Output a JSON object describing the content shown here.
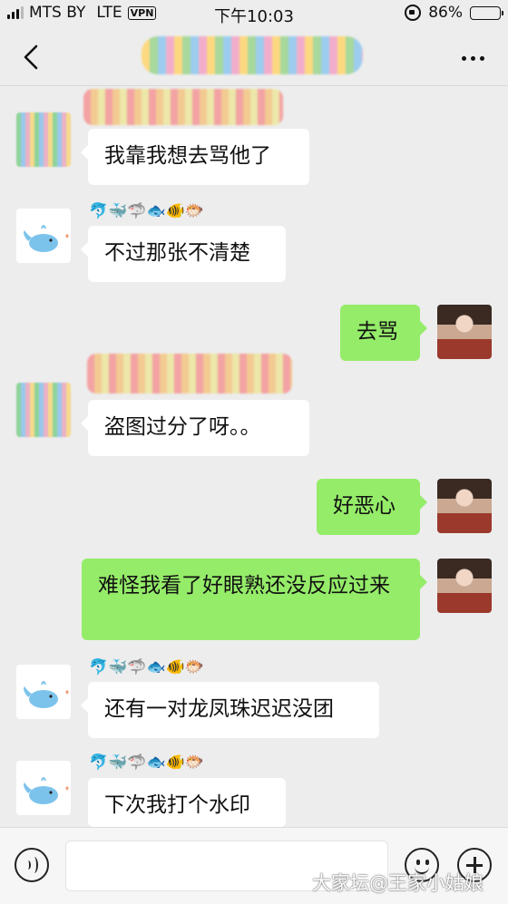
{
  "status_bar": {
    "carrier": "MTS BY",
    "network": "LTE",
    "vpn": "VPN",
    "time": "下午10:03",
    "battery": "86%",
    "battery_level": 0.86
  },
  "chat": {
    "messages": [
      {
        "side": "in",
        "text": "我靠我想去骂他了",
        "avatar": "pixelated",
        "nickname": "pixelated"
      },
      {
        "side": "in",
        "text": "不过那张不清楚",
        "avatar": "whale",
        "nickname_emoji": "🐬🐳🦈🐟🐠🐡"
      },
      {
        "side": "out",
        "text": "去骂",
        "avatar": "photo"
      },
      {
        "side": "in",
        "text": "盗图过分了呀。。",
        "avatar": "pixelated",
        "nickname": "pixelated"
      },
      {
        "side": "out",
        "text": "好恶心",
        "avatar": "photo"
      },
      {
        "side": "out",
        "text": "难怪我看了好眼熟还没反应过来",
        "avatar": "photo"
      },
      {
        "side": "in",
        "text": "还有一对龙凤珠迟迟没团",
        "avatar": "whale",
        "nickname_emoji": "🐬🐳🦈🐟🐠🐡"
      },
      {
        "side": "in",
        "text": "下次我打个水印",
        "avatar": "whale",
        "nickname_emoji": "🐬🐳🦈🐟🐠🐡"
      }
    ]
  },
  "input_bar": {
    "voice_icon": "voice-icon",
    "emoji_icon": "emoji-icon",
    "plus_icon": "plus-icon"
  },
  "watermark": "大家坛@王家小姑娘",
  "colors": {
    "background": "#ededed",
    "outgoing_bubble": "#95ec69",
    "incoming_bubble": "#ffffff"
  }
}
